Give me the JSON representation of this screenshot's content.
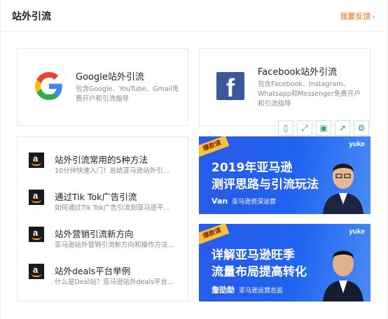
{
  "header": {
    "title": "站外引流",
    "feedback_label": "我要反馈",
    "feedback_arrow": "›"
  },
  "google_card": {
    "title": "Google站外引流",
    "desc": "包含Google、YouTube、Gmail免费开户和引流指导"
  },
  "facebook_card": {
    "title": "Facebook站外引流",
    "desc": "包含Facebook、Instagram、Whatsapp和Messenger免费开户和引流指导",
    "logo_letter": "f"
  },
  "list": [
    {
      "title": "站外引流常用的5种方法",
      "sub": "10分钟快速入门！总结亚马逊站外引..."
    },
    {
      "title": "通过Tik Tok广告引流",
      "sub": "如何通过Tik Tok广告引流到亚马逊平..."
    },
    {
      "title": "站外营销引流新方向",
      "sub": "亚马逊站外营销引流新方向和操作方法..."
    },
    {
      "title": "站外deals平台举例",
      "sub": "什么是Deal站？亚马逊站外deals平台..."
    }
  ],
  "amazon_letter": "a",
  "toolbar": {
    "icons": [
      "phone-icon",
      "expand-icon",
      "save-icon",
      "share-icon",
      "settings-icon"
    ]
  },
  "banners": [
    {
      "tag": "爆款课",
      "brand": "yuke",
      "line1": "2019年亚马逊",
      "line2": "测评思路与引流玩法",
      "speaker": "Van",
      "speaker_role": "亚马逊资深运营"
    },
    {
      "tag": "爆款课",
      "brand": "yuke",
      "line1": "详解亚马逊旺季",
      "line2": "流量布局提高转化",
      "speaker": "詹劭勋",
      "speaker_role": "亚马逊运营总监"
    }
  ],
  "colors": {
    "accent": "#ff6a00",
    "toolbar": "#2e9e6a",
    "banner_blue": "#1f63f0",
    "facebook_blue": "#3b5998"
  }
}
